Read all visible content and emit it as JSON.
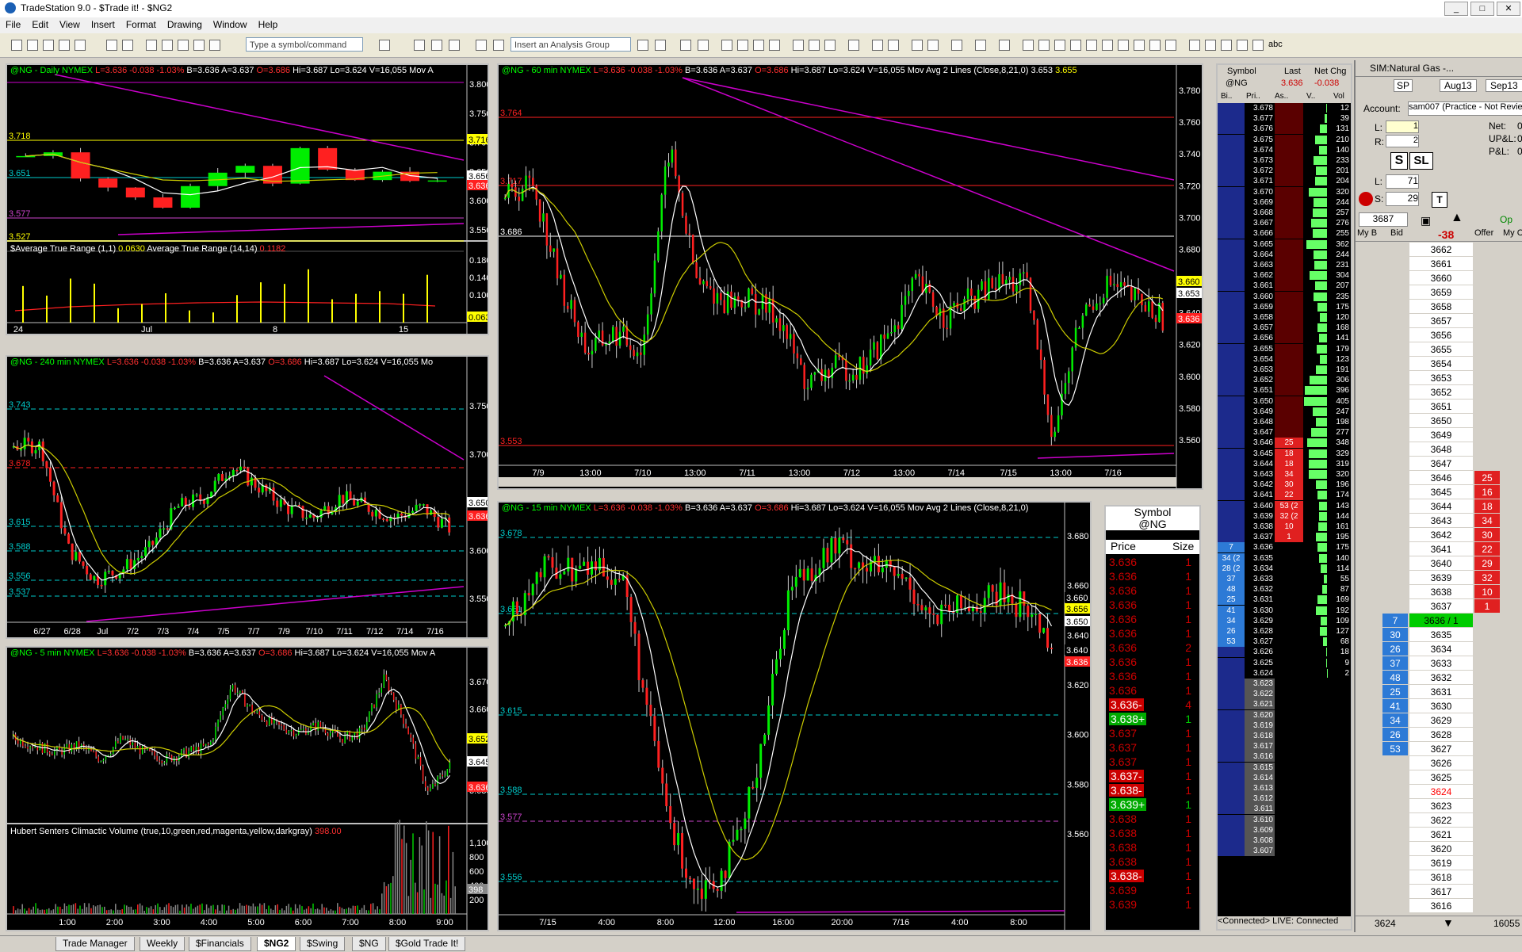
{
  "app": {
    "title": "TradeStation 9.0 - $Trade it! - $NG2",
    "minimize": "_",
    "maximize": "□",
    "close": "✕"
  },
  "menu": [
    "File",
    "Edit",
    "View",
    "Insert",
    "Format",
    "Drawing",
    "Window",
    "Help"
  ],
  "toolbar": {
    "symbol_placeholder": "Type a symbol/command",
    "analysis_placeholder": "Insert an Analysis Group",
    "abc": "abc"
  },
  "charts": {
    "daily": {
      "header": [
        [
          "@NG - Daily NYMEX ",
          "g"
        ],
        [
          "L=3.636 -0.038 -1.03% ",
          "r"
        ],
        [
          "B=3.636 A=3.637 ",
          "w"
        ],
        [
          "O=3.686 ",
          "r"
        ],
        [
          "Hi=3.687 Lo=3.624 V=16,055 Mov A",
          "w"
        ]
      ],
      "ind_header": [
        [
          "$Average True Range (1,1) ",
          "w"
        ],
        [
          "0.0630 ",
          "y"
        ],
        [
          "Average True Range (14,14) ",
          "w"
        ],
        [
          "0.1182",
          "r"
        ]
      ],
      "yticks": [
        "3.800",
        "3.750",
        "3.700",
        "3.650",
        "3.600",
        "3.550"
      ],
      "ind_yticks": [
        "0.180",
        "0.140",
        "0.100"
      ],
      "xticks": [
        "24",
        "Jul",
        "8",
        "15"
      ],
      "levels": [
        "3.718",
        "3.651",
        "3.577",
        "3.527"
      ],
      "price_tags": [
        "3.716",
        "3.656",
        "3.636"
      ],
      "ind_tags": [
        "0.063"
      ]
    },
    "h240": {
      "header": [
        [
          "@NG - 240 min NYMEX ",
          "g"
        ],
        [
          "L=3.636 -0.038 -1.03% ",
          "r"
        ],
        [
          "B=3.636 A=3.637 ",
          "w"
        ],
        [
          "O=3.686 ",
          "r"
        ],
        [
          "Hi=3.687 Lo=3.624 V=16,055 Mo",
          "w"
        ]
      ],
      "yticks": [
        "3.750",
        "3.700",
        "3.650",
        "3.600",
        "3.550"
      ],
      "xticks": [
        "6/27",
        "6/28",
        "Jul",
        "7/2",
        "7/3",
        "7/4",
        "7/5",
        "7/7",
        "7/9",
        "7/10",
        "7/11",
        "7/12",
        "7/14",
        "7/16"
      ],
      "levels": [
        "3.743",
        "3.678",
        "3.615",
        "3.588",
        "3.556",
        "3.537"
      ],
      "price_tags": [
        "3.650",
        "3.636"
      ]
    },
    "m5": {
      "header": [
        [
          "@NG - 5 min NYMEX ",
          "g"
        ],
        [
          "L=3.636 -0.038 -1.03% ",
          "r"
        ],
        [
          "B=3.636 A=3.637 ",
          "w"
        ],
        [
          "O=3.686 ",
          "r"
        ],
        [
          "Hi=3.687 Lo=3.624 V=16,055 Mov A",
          "w"
        ]
      ],
      "ind_header": [
        [
          "Hubert Senters Climactic Volume (true,10,green,red,magenta,yellow,darkgray) ",
          "w"
        ],
        [
          "398.00",
          "r"
        ]
      ],
      "yticks": [
        "3.670",
        "3.660",
        "3.650",
        "3.640",
        "3.630"
      ],
      "ind_yticks": [
        "1,100",
        "800",
        "600",
        "400",
        "200"
      ],
      "xticks": [
        "1:00",
        "2:00",
        "3:00",
        "4:00",
        "5:00",
        "6:00",
        "7:00",
        "8:00",
        "9:00"
      ],
      "price_tags": [
        "3.652",
        "3.645",
        "3.636"
      ],
      "ind_tags": [
        "398"
      ]
    },
    "h60": {
      "header": [
        [
          "@NG - 60 min NYMEX ",
          "g"
        ],
        [
          "L=3.636 -0.038 -1.03% ",
          "r"
        ],
        [
          "B=3.636 A=3.637 ",
          "w"
        ],
        [
          "O=3.686 ",
          "r"
        ],
        [
          "Hi=3.687 Lo=3.624 V=16,055 ",
          "w"
        ],
        [
          "Mov Avg 2 Lines (Close,8,21,0) ",
          "w"
        ],
        [
          "3.653 ",
          "w"
        ],
        [
          "3.655",
          "y"
        ]
      ],
      "yticks": [
        "3.780",
        "3.760",
        "3.740",
        "3.720",
        "3.700",
        "3.680",
        "3.660",
        "3.640",
        "3.620",
        "3.600",
        "3.580",
        "3.560"
      ],
      "xticks": [
        "7/9",
        "13:00",
        "7/10",
        "13:00",
        "7/11",
        "13:00",
        "7/12",
        "13:00",
        "7/14",
        "7/15",
        "13:00",
        "7/16"
      ],
      "levels": [
        "3.764",
        "3.717",
        "3.686",
        "3.553"
      ],
      "price_tags": [
        "3.660",
        "3.653",
        "3.636"
      ]
    },
    "m15": {
      "header": [
        [
          "@NG - 15 min NYMEX ",
          "g"
        ],
        [
          "L=3.636 -0.038 -1.03% ",
          "r"
        ],
        [
          "B=3.636 A=3.637 ",
          "w"
        ],
        [
          "O=3.686 ",
          "r"
        ],
        [
          "Hi=3.687 Lo=3.624 V=16,055 ",
          "w"
        ],
        [
          "Mov Avg 2 Lines (Close,8,21,0)",
          "w"
        ]
      ],
      "yticks": [
        "3.680",
        "3.660",
        "3.640",
        "3.620",
        "3.600",
        "3.580",
        "3.560"
      ],
      "xticks": [
        "7/15",
        "4:00",
        "8:00",
        "12:00",
        "16:00",
        "20:00",
        "7/16",
        "4:00",
        "8:00"
      ],
      "levels": [
        "3.678",
        "3.651",
        "3.615",
        "3.588",
        "3.577",
        "3.556"
      ],
      "price_tags": [
        "3.660",
        "3.656",
        "3.650",
        "3.640",
        "3.636"
      ]
    }
  },
  "timesales": {
    "symbol_label": "Symbol",
    "symbol": "@NG",
    "col_price": "Price",
    "col_size": "Size",
    "rows": [
      [
        "3.636",
        "1",
        "r"
      ],
      [
        "3.636",
        "1",
        "r"
      ],
      [
        "3.636",
        "1",
        "r"
      ],
      [
        "3.636",
        "1",
        "r"
      ],
      [
        "3.636",
        "1",
        "r"
      ],
      [
        "3.636",
        "1",
        "r"
      ],
      [
        "3.636",
        "2",
        "r"
      ],
      [
        "3.636",
        "1",
        "r"
      ],
      [
        "3.636",
        "1",
        "r"
      ],
      [
        "3.636",
        "1",
        "r"
      ],
      [
        "3.636-",
        "4",
        "rb"
      ],
      [
        "3.638+",
        "1",
        "gb"
      ],
      [
        "3.637",
        "1",
        "r"
      ],
      [
        "3.637",
        "1",
        "r"
      ],
      [
        "3.637",
        "1",
        "r"
      ],
      [
        "3.637-",
        "1",
        "rb"
      ],
      [
        "3.638-",
        "1",
        "rb"
      ],
      [
        "3.639+",
        "1",
        "gb"
      ],
      [
        "3.638",
        "1",
        "r"
      ],
      [
        "3.638",
        "1",
        "r"
      ],
      [
        "3.638",
        "1",
        "r"
      ],
      [
        "3.638",
        "1",
        "r"
      ],
      [
        "3.638-",
        "1",
        "rb"
      ],
      [
        "3.639",
        "1",
        "r"
      ],
      [
        "3.639",
        "1",
        "r"
      ]
    ]
  },
  "radar": {
    "cols": [
      "Symbol",
      "Last",
      "Net Chg"
    ],
    "sym": "@NG",
    "last": "3.636",
    "chg": "-0.038",
    "subcols": [
      "Bi..",
      "Pri..",
      "As..",
      "V..",
      "Vol"
    ],
    "levels": [
      [
        "3.678",
        "",
        "",
        "12"
      ],
      [
        "3.677",
        "",
        "",
        "39"
      ],
      [
        "3.676",
        "",
        "",
        "131"
      ],
      [
        "3.675",
        "",
        "",
        "210"
      ],
      [
        "3.674",
        "",
        "",
        "140"
      ],
      [
        "3.673",
        "",
        "",
        "233"
      ],
      [
        "3.672",
        "",
        "",
        "201"
      ],
      [
        "3.671",
        "",
        "",
        "204"
      ],
      [
        "3.670",
        "",
        "",
        "320"
      ],
      [
        "3.669",
        "",
        "",
        "244"
      ],
      [
        "3.668",
        "",
        "",
        "257"
      ],
      [
        "3.667",
        "",
        "",
        "276"
      ],
      [
        "3.666",
        "",
        "",
        "255"
      ],
      [
        "3.665",
        "",
        "",
        "362"
      ],
      [
        "3.664",
        "",
        "",
        "244"
      ],
      [
        "3.663",
        "",
        "",
        "231"
      ],
      [
        "3.662",
        "",
        "",
        "304"
      ],
      [
        "3.661",
        "",
        "",
        "207"
      ],
      [
        "3.660",
        "",
        "",
        "235"
      ],
      [
        "3.659",
        "",
        "",
        "175"
      ],
      [
        "3.658",
        "",
        "",
        "120"
      ],
      [
        "3.657",
        "",
        "",
        "168"
      ],
      [
        "3.656",
        "",
        "",
        "141"
      ],
      [
        "3.655",
        "",
        "",
        "179"
      ],
      [
        "3.654",
        "",
        "",
        "123"
      ],
      [
        "3.653",
        "",
        "",
        "191"
      ],
      [
        "3.652",
        "",
        "",
        "306"
      ],
      [
        "3.651",
        "",
        "",
        "396"
      ],
      [
        "3.650",
        "",
        "",
        "405"
      ],
      [
        "3.649",
        "",
        "",
        "247"
      ],
      [
        "3.648",
        "",
        "",
        "198"
      ],
      [
        "3.647",
        "",
        "",
        "277"
      ],
      [
        "3.646",
        "",
        "25",
        "348"
      ],
      [
        "3.645",
        "",
        "18",
        "329"
      ],
      [
        "3.644",
        "",
        "18",
        "319"
      ],
      [
        "3.643",
        "",
        "34",
        "320"
      ],
      [
        "3.642",
        "",
        "30",
        "196"
      ],
      [
        "3.641",
        "",
        "22",
        "174"
      ],
      [
        "3.640",
        "",
        "53 (2",
        "143"
      ],
      [
        "3.639",
        "",
        "32 (2",
        "144"
      ],
      [
        "3.638",
        "",
        "10",
        "161"
      ],
      [
        "3.637",
        "",
        "1",
        "195"
      ],
      [
        "3.636",
        "7",
        "",
        "175"
      ],
      [
        "3.635",
        "34 (2",
        "",
        "140"
      ],
      [
        "3.634",
        "28 (2",
        "",
        "114"
      ],
      [
        "3.633",
        "37",
        "",
        "55"
      ],
      [
        "3.632",
        "48",
        "",
        "87"
      ],
      [
        "3.631",
        "25",
        "",
        "169"
      ],
      [
        "3.630",
        "41",
        "",
        "192"
      ],
      [
        "3.629",
        "34",
        "",
        "109"
      ],
      [
        "3.628",
        "26",
        "",
        "127"
      ],
      [
        "3.627",
        "53",
        "",
        "68"
      ],
      [
        "3.626",
        "",
        "",
        "18"
      ],
      [
        "3.625",
        "",
        "",
        "9"
      ],
      [
        "3.624",
        "",
        "",
        "2"
      ],
      [
        "3.623",
        "",
        "",
        ""
      ],
      [
        "3.622",
        "",
        "",
        ""
      ],
      [
        "3.621",
        "",
        "",
        ""
      ],
      [
        "3.620",
        "",
        "",
        ""
      ],
      [
        "3.619",
        "",
        "",
        ""
      ],
      [
        "3.618",
        "",
        "",
        ""
      ],
      [
        "3.617",
        "",
        "",
        ""
      ],
      [
        "3.616",
        "",
        "",
        ""
      ],
      [
        "3.615",
        "",
        "",
        ""
      ],
      [
        "3.614",
        "",
        "",
        ""
      ],
      [
        "3.613",
        "",
        "",
        ""
      ],
      [
        "3.612",
        "",
        "",
        ""
      ],
      [
        "3.611",
        "",
        "",
        ""
      ],
      [
        "3.610",
        "",
        "",
        ""
      ],
      [
        "3.609",
        "",
        "",
        ""
      ],
      [
        "3.608",
        "",
        "",
        ""
      ],
      [
        "3.607",
        "",
        "",
        ""
      ]
    ],
    "status": "<Connected> LIVE: Connected"
  },
  "dom": {
    "title": "SIM:Natural Gas -...",
    "sp": "SP",
    "month1": "Aug13",
    "month2": "Sep13",
    "account_label": "Account:",
    "account": "sam007 (Practice - Not Revie",
    "l_label": "L:",
    "l_val": "1",
    "r_label": "R:",
    "r_val": "2",
    "net_label": "Net:",
    "net_val": "0",
    "upl_label": "UP&L:",
    "upl_val": "0.",
    "pl_label": "P&L:",
    "pl_val": "0.",
    "s_btn": "S",
    "sl_btn": "SL",
    "l2_label": "L:",
    "l2_val": "71",
    "s2_label": "S:",
    "s2_val": "29",
    "t_btn": "T",
    "price_box": "3687",
    "chg": "-38",
    "op_label": "Op",
    "col_mybid": "My B",
    "col_bid": "Bid",
    "col_offer": "Offer",
    "col_myoffer": "My C",
    "ladder": [
      [
        "3662",
        "",
        ""
      ],
      [
        "3661",
        "",
        ""
      ],
      [
        "3660",
        "",
        ""
      ],
      [
        "3659",
        "",
        ""
      ],
      [
        "3658",
        "",
        ""
      ],
      [
        "3657",
        "",
        ""
      ],
      [
        "3656",
        "",
        ""
      ],
      [
        "3655",
        "",
        ""
      ],
      [
        "3654",
        "",
        ""
      ],
      [
        "3653",
        "",
        ""
      ],
      [
        "3652",
        "",
        ""
      ],
      [
        "3651",
        "",
        ""
      ],
      [
        "3650",
        "",
        ""
      ],
      [
        "3649",
        "",
        ""
      ],
      [
        "3648",
        "",
        ""
      ],
      [
        "3647",
        "",
        ""
      ],
      [
        "3646",
        "",
        "25"
      ],
      [
        "3645",
        "",
        "16"
      ],
      [
        "3644",
        "",
        "18"
      ],
      [
        "3643",
        "",
        "34"
      ],
      [
        "3642",
        "",
        "30"
      ],
      [
        "3641",
        "",
        "22"
      ],
      [
        "3640",
        "",
        "29"
      ],
      [
        "3639",
        "",
        "32"
      ],
      [
        "3638",
        "",
        "10"
      ],
      [
        "3637",
        "",
        "1"
      ],
      [
        "3636 / 1",
        "7",
        ""
      ],
      [
        "3635",
        "30",
        ""
      ],
      [
        "3634",
        "26",
        ""
      ],
      [
        "3633",
        "37",
        ""
      ],
      [
        "3632",
        "48",
        ""
      ],
      [
        "3631",
        "25",
        ""
      ],
      [
        "3630",
        "41",
        ""
      ],
      [
        "3629",
        "34",
        ""
      ],
      [
        "3628",
        "26",
        ""
      ],
      [
        "3627",
        "53",
        ""
      ],
      [
        "3626",
        "",
        ""
      ],
      [
        "3625",
        "",
        ""
      ],
      [
        "3624",
        "",
        ""
      ],
      [
        "3623",
        "",
        ""
      ],
      [
        "3622",
        "",
        ""
      ],
      [
        "3621",
        "",
        ""
      ],
      [
        "3620",
        "",
        ""
      ],
      [
        "3619",
        "",
        ""
      ],
      [
        "3618",
        "",
        ""
      ],
      [
        "3617",
        "",
        ""
      ],
      [
        "3616",
        "",
        ""
      ]
    ],
    "footer_left": "3624",
    "footer_right": "16055"
  },
  "tabs": [
    "Trade Manager",
    "Weekly",
    "$Financials",
    "$NG2",
    "$Swing",
    "$NG",
    "$Gold Trade It!"
  ],
  "active_tab": "$NG2"
}
